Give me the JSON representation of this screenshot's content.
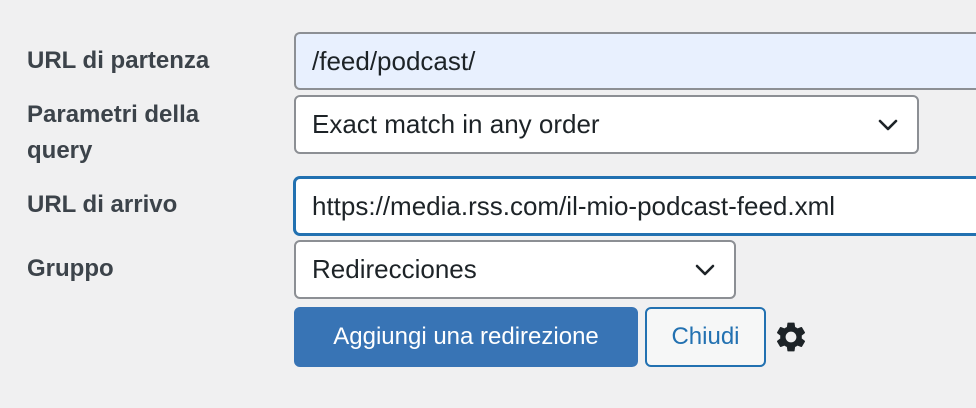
{
  "form": {
    "source_url": {
      "label": "URL di partenza",
      "value": "/feed/podcast/"
    },
    "query_params": {
      "label": "Parametri della query",
      "label_line1": "Parametri della",
      "label_line2": "query",
      "selected": "Exact match in any order"
    },
    "target_url": {
      "label": "URL di arrivo",
      "value": "https://media.rss.com/il-mio-podcast-feed.xml"
    },
    "group": {
      "label": "Gruppo",
      "selected": "Redirecciones"
    },
    "actions": {
      "add_label": "Aggiungi una redirezione",
      "close_label": "Chiudi",
      "settings_icon": "gear-icon"
    }
  },
  "colors": {
    "background": "#f0f0f1",
    "primary": "#3874b5",
    "focus": "#2271b1",
    "autofill": "#e8f0fe",
    "label": "#3c434a"
  }
}
